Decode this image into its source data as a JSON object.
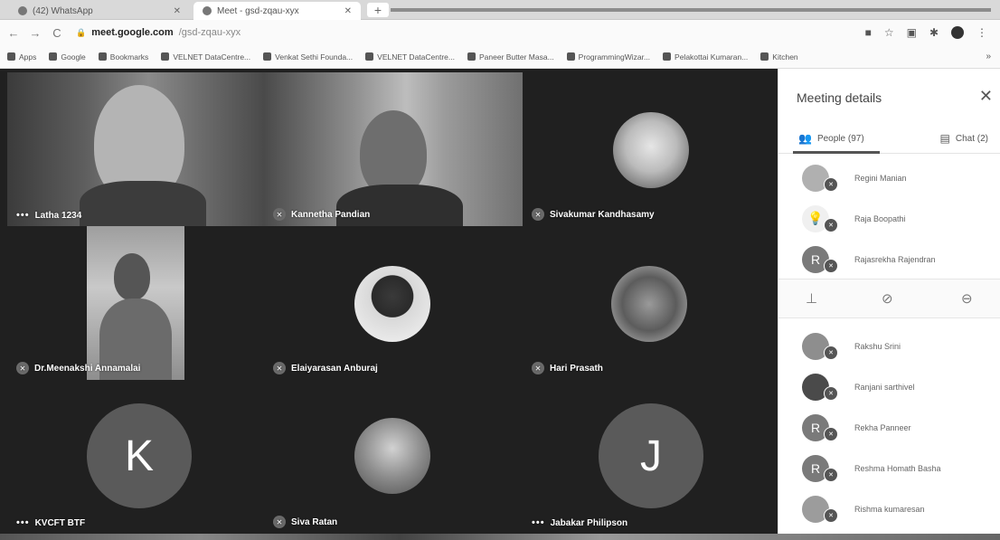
{
  "browser": {
    "tabs": [
      {
        "label": "(42) WhatsApp"
      },
      {
        "label": "Meet - gsd-zqau-xyx"
      }
    ],
    "url_host": "meet.google.com",
    "url_path": "/gsd-zqau-xyx",
    "bookmarks": [
      "Apps",
      "Google",
      "Bookmarks",
      "VELNET DataCentre...",
      "Venkat Sethi Founda...",
      "VELNET DataCentre...",
      "Paneer Butter Masa...",
      "ProgrammingWizar...",
      "Pelakottai Kumaran...",
      "Kitchen"
    ]
  },
  "tiles": [
    {
      "name": "Latha 1234"
    },
    {
      "name": "Kannetha Pandian"
    },
    {
      "name": "Sivakumar Kandhasamy"
    },
    {
      "name": "Dr.Meenakshi Annamalai"
    },
    {
      "name": "Elaiyarasan Anburaj"
    },
    {
      "name": "Hari Prasath"
    },
    {
      "name": "KVCFT BTF",
      "letter": "K"
    },
    {
      "name": "Siva Ratan"
    },
    {
      "name": "Jabakar Philipson",
      "letter": "J"
    }
  ],
  "panel": {
    "title": "Meeting details",
    "people_tab": "People (97)",
    "chat_tab": "Chat (2)",
    "people_top": [
      {
        "name": "Regini Manian"
      },
      {
        "name": "Raja Boopathi"
      },
      {
        "name": "Rajasrekha Rajendran",
        "initial": "R"
      }
    ],
    "people_bottom": [
      {
        "name": "Rakshu Srini"
      },
      {
        "name": "Ranjani sarthivel"
      },
      {
        "name": "Rekha Panneer",
        "initial": "R"
      },
      {
        "name": "Reshma Homath Basha",
        "initial": "R"
      },
      {
        "name": "Rishma kumaresan"
      }
    ]
  }
}
